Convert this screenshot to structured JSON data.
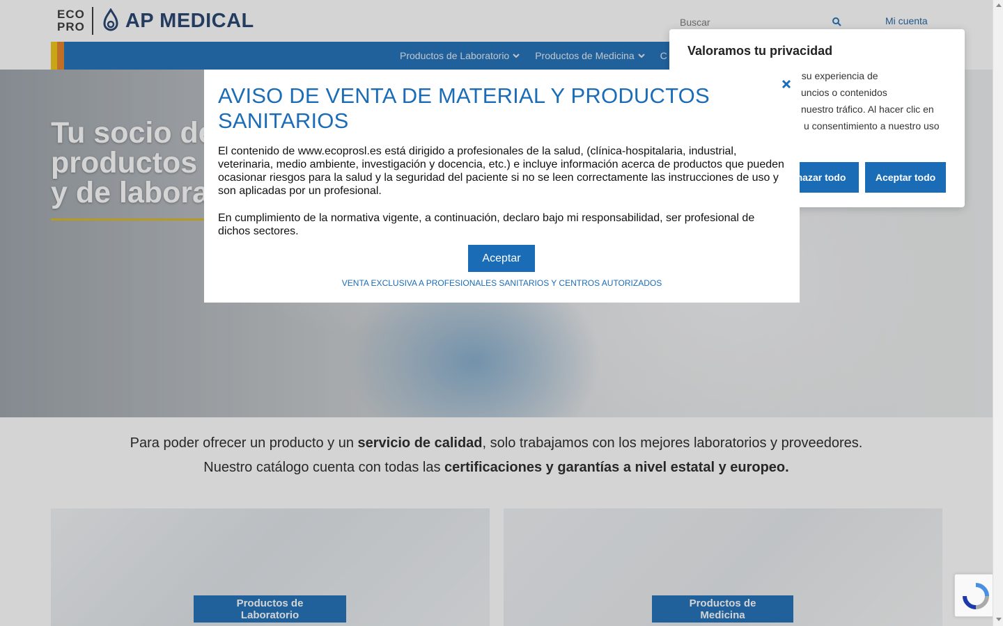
{
  "header": {
    "logo_eco_line1": "ECO",
    "logo_eco_line2": "PRO",
    "logo_brand": "AP MEDICAL",
    "search_placeholder": "Buscar",
    "account_label": "Mi cuenta"
  },
  "nav": {
    "items": [
      {
        "label": "Productos de Laboratorio",
        "icon": "chevron-down-icon"
      },
      {
        "label": "Productos de Medicina",
        "icon": "chevron-down-icon"
      },
      {
        "label": "C"
      }
    ]
  },
  "hero": {
    "title_line1": "Tu socio de",
    "title_line2": "productos m",
    "title_line3": "y de laborat"
  },
  "intro": {
    "line1_pre": "Para poder ofrecer un producto y un ",
    "line1_bold": "servicio de calidad",
    "line1_post": ", solo trabajamos con los mejores laboratorios y proveedores.",
    "line2_pre": "Nuestro catálogo cuenta con todas las ",
    "line2_bold": "certificaciones y garantías a nivel estatal y europeo."
  },
  "categories": [
    {
      "label": "Productos de Laboratorio"
    },
    {
      "label": "Productos de Medicina"
    }
  ],
  "privacy": {
    "title": "Valoramos tu privacidad",
    "line1": "orar su experiencia de",
    "line2": "uncios o contenidos",
    "line3": "nuestro tráfico. Al hacer clic en",
    "line4": "u consentimiento a nuestro uso",
    "reject_label": "hazar todo",
    "accept_label": "Aceptar todo"
  },
  "modal": {
    "title": "AVISO DE VENTA DE MATERIAL Y PRODUCTOS SANITARIOS",
    "paragraph1": "El contenido de www.ecoprosl.es está dirigido a profesionales de la salud, (clínica-hospitalaria, industrial, veterinaria, medio ambiente, investigación y docencia, etc.) e incluye información acerca de productos que pueden ocasionar riesgos para la salud y la seguridad del paciente si no se leen correctamente las instrucciones de uso y son aplicadas por un profesional.",
    "paragraph2": "En cumplimiento de la normativa vigente, a continuación, declaro bajo mi responsabilidad, ser profesional de dichos sectores.",
    "accept_label": "Aceptar",
    "note": "VENTA EXCLUSIVA A PROFESIONALES SANITARIOS Y CENTROS AUTORIZADOS"
  },
  "colors": {
    "brand_blue": "#1a6cb6",
    "logo_navy": "#1d3d6b",
    "accent_gold": "#d89a14",
    "hero_underline": "#d9b61d"
  }
}
